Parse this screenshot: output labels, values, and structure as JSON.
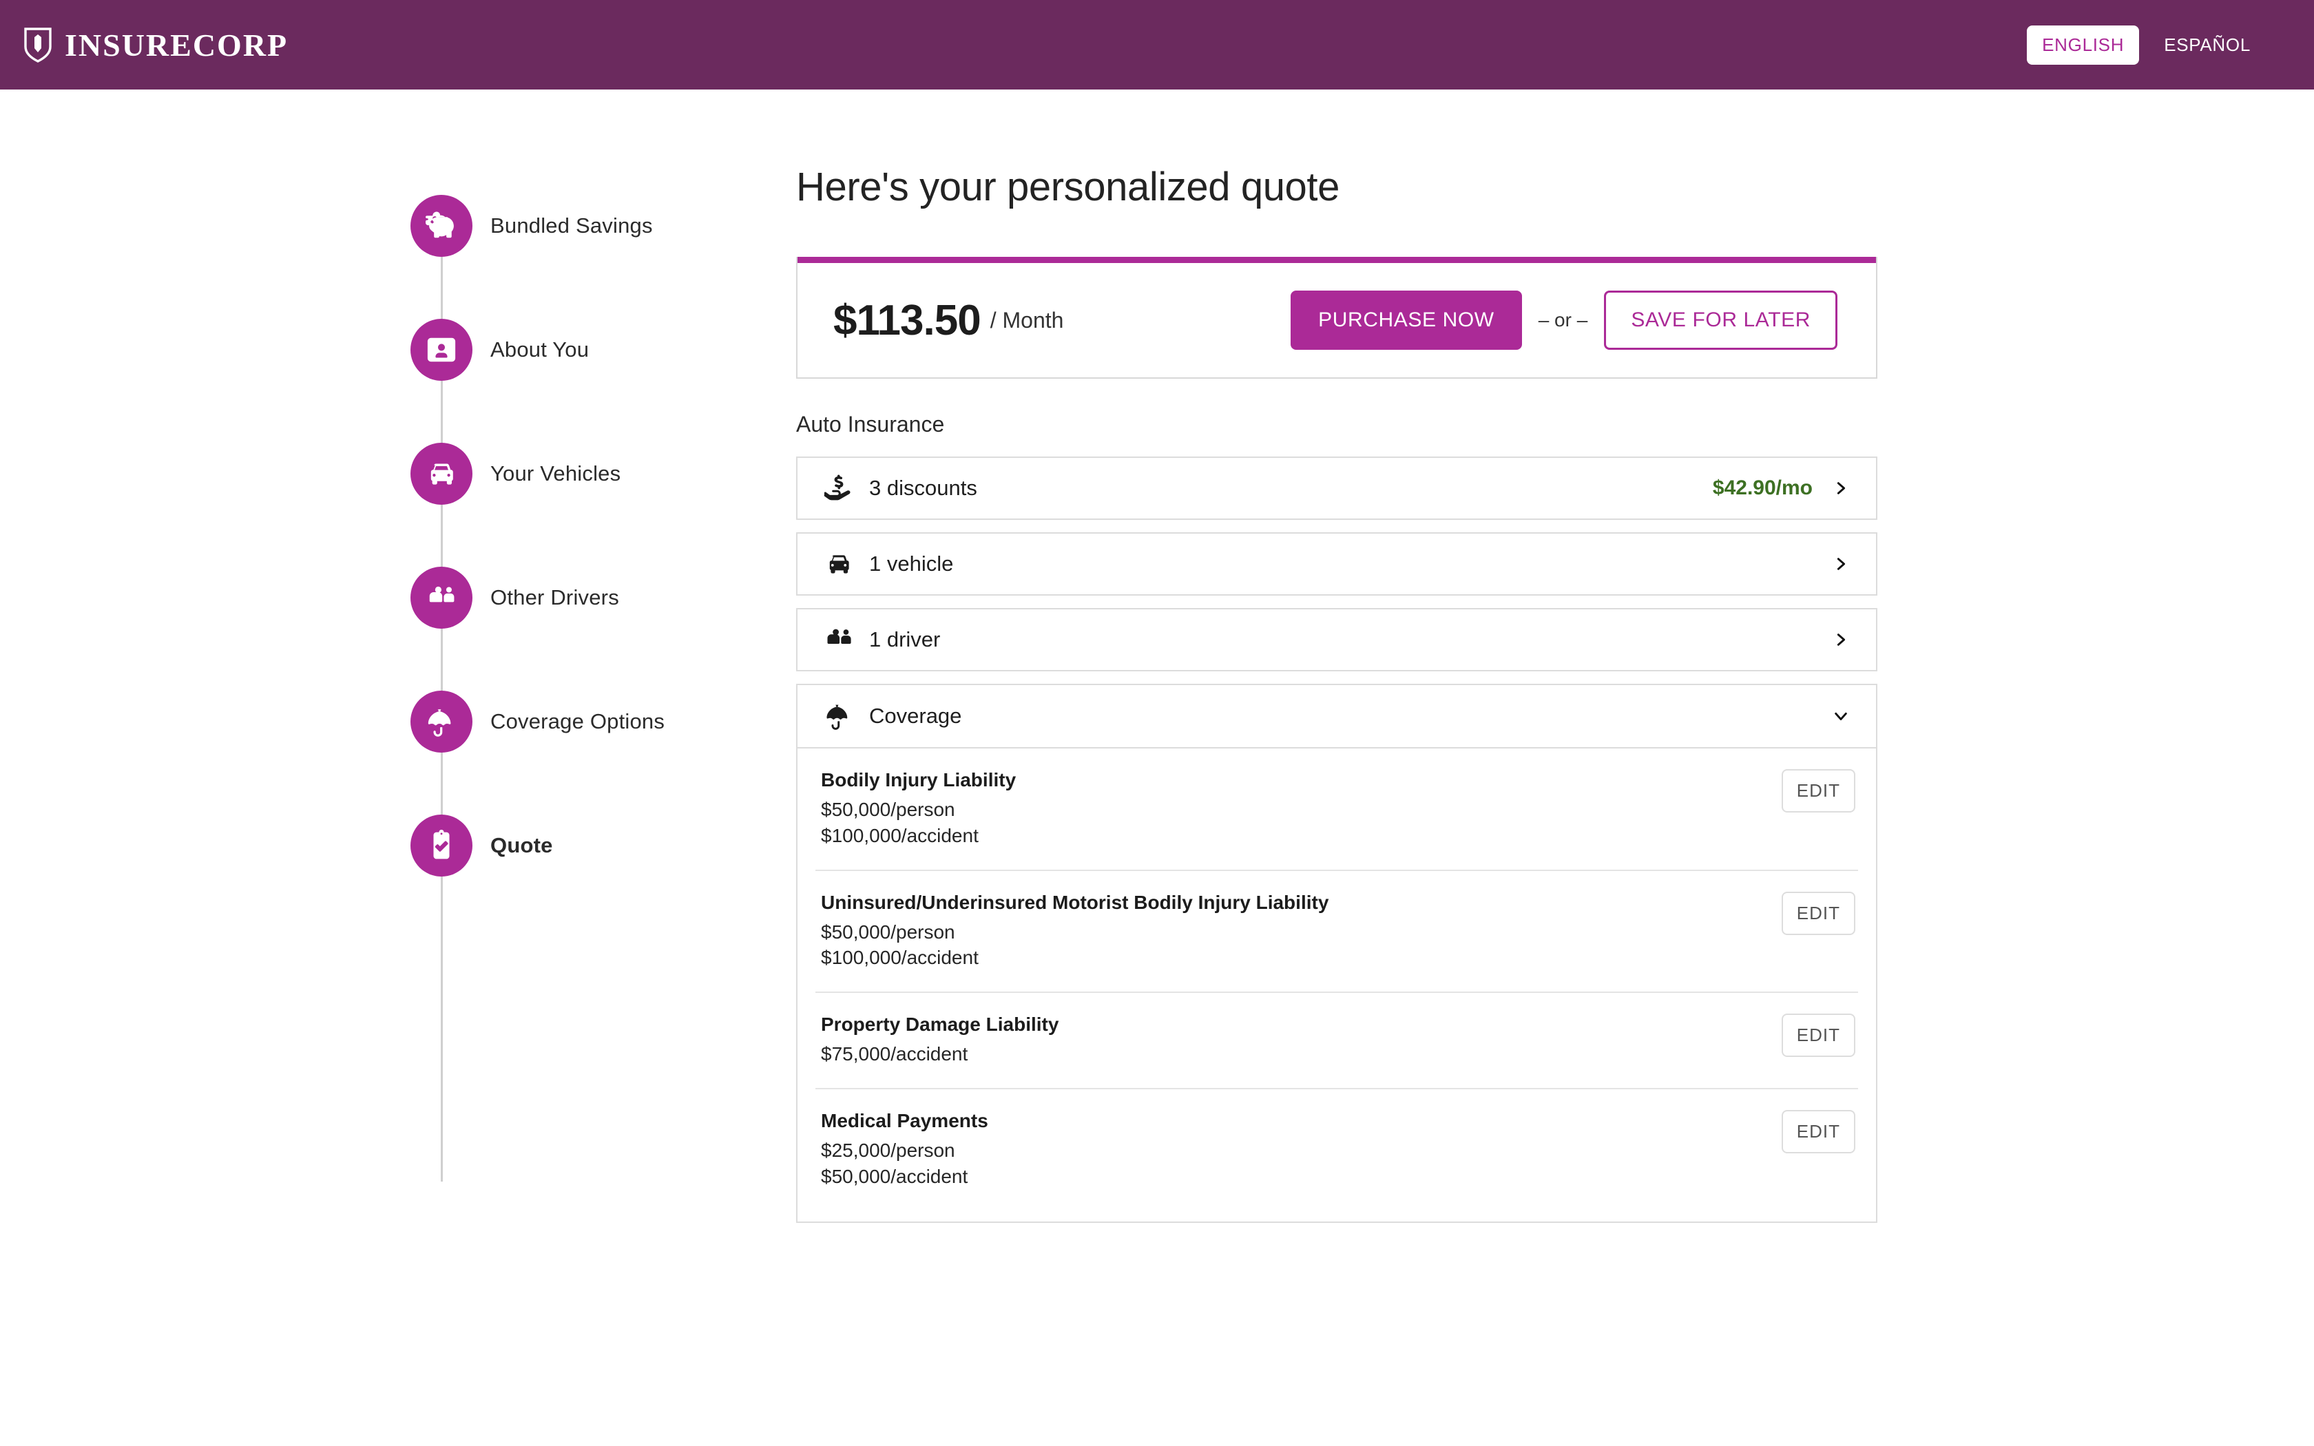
{
  "header": {
    "brand_name": "INSURECORP",
    "brand_icon": "shield-icon",
    "lang_english": "ENGLISH",
    "lang_spanish": "ESPAÑOL",
    "bg_color": "#6b2a5e"
  },
  "theme": {
    "accent": "#ab2a97",
    "header_purple": "#6b2a5e",
    "discount_green": "#3d7023"
  },
  "stepper": {
    "steps": [
      {
        "label": "Bundled Savings",
        "icon": "piggy-bank-icon",
        "current": false
      },
      {
        "label": "About You",
        "icon": "id-card-icon",
        "current": false
      },
      {
        "label": "Your Vehicles",
        "icon": "car-icon",
        "current": false
      },
      {
        "label": "Other Drivers",
        "icon": "people-icon",
        "current": false
      },
      {
        "label": "Coverage Options",
        "icon": "umbrella-icon",
        "current": false
      },
      {
        "label": "Quote",
        "icon": "clipboard-check-icon",
        "current": true
      }
    ]
  },
  "main": {
    "title": "Here's your personalized quote",
    "price": {
      "amount": "$113.50",
      "period": "/ Month",
      "purchase_label": "PURCHASE NOW",
      "or_label": "– or –",
      "save_label": "SAVE FOR LATER"
    },
    "section_label": "Auto Insurance",
    "summary_rows": [
      {
        "label": "3 discounts",
        "icon": "hand-holding-dollar-icon",
        "amount": "$42.90/mo",
        "chevron": "chevron-right-icon"
      },
      {
        "label": "1 vehicle",
        "icon": "car-front-icon",
        "amount": "",
        "chevron": "chevron-right-icon"
      },
      {
        "label": "1 driver",
        "icon": "people-icon",
        "amount": "",
        "chevron": "chevron-right-icon"
      }
    ],
    "coverage": {
      "label": "Coverage",
      "icon": "umbrella-icon",
      "chevron": "chevron-down-icon",
      "edit_label": "EDIT",
      "items": [
        {
          "name": "Bodily Injury Liability",
          "line1": "$50,000/person",
          "line2": "$100,000/accident"
        },
        {
          "name": "Uninsured/Underinsured Motorist Bodily Injury Liability",
          "line1": "$50,000/person",
          "line2": "$100,000/accident"
        },
        {
          "name": "Property Damage Liability",
          "line1": "$75,000/accident",
          "line2": ""
        },
        {
          "name": "Medical Payments",
          "line1": "$25,000/person",
          "line2": "$50,000/accident"
        }
      ]
    }
  }
}
